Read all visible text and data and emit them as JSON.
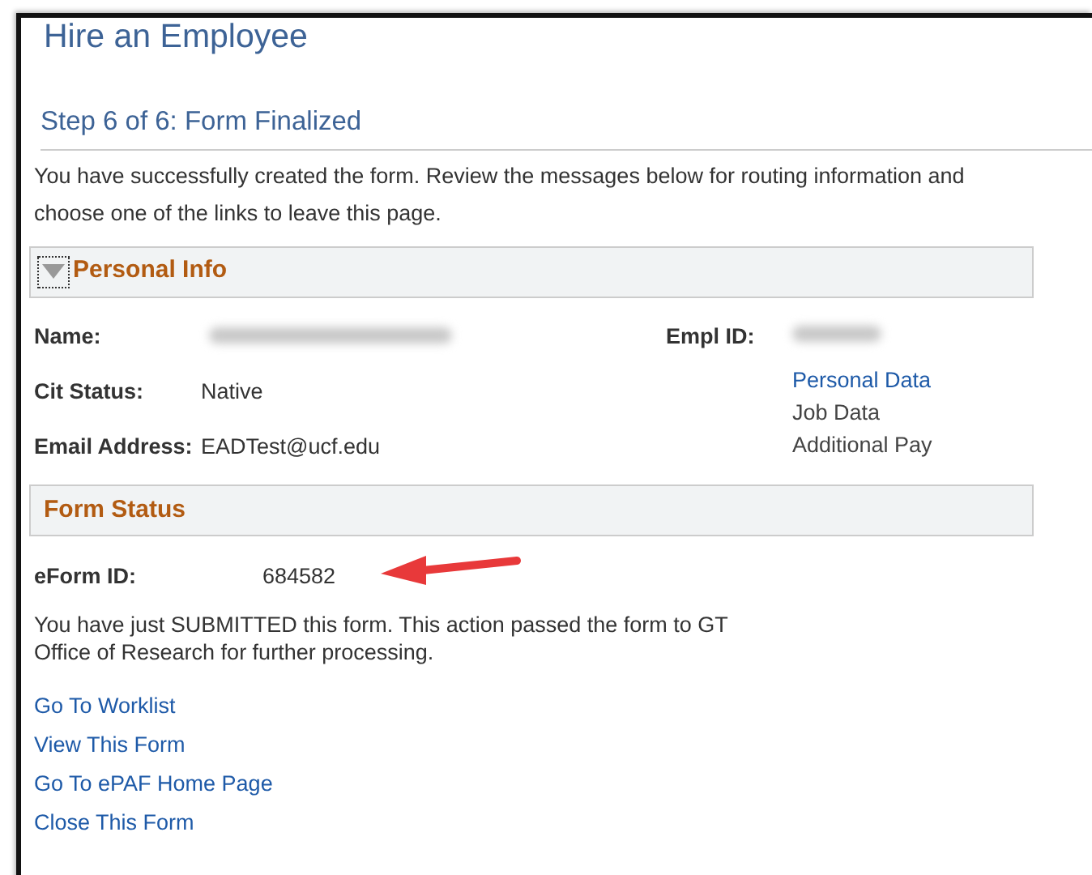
{
  "page_title": "Hire an Employee",
  "step_title": "Step 6 of 6: Form Finalized",
  "intro": "You have successfully created the form. Review the messages below for routing information and choose one of the links to leave this page.",
  "personal_info": {
    "header": "Personal Info",
    "expanded": true,
    "fields": [
      {
        "label": "Name:",
        "redacted": true
      },
      {
        "label": "Cit Status:",
        "value": "Native"
      },
      {
        "label": "Email Address:",
        "value": "EADTest@ucf.edu"
      }
    ],
    "empl_id": {
      "label": "Empl ID:",
      "redacted": true
    },
    "links": [
      {
        "text": "Personal Data",
        "disabled": false
      },
      {
        "text": "Job Data",
        "disabled": true
      },
      {
        "text": "Additional Pay",
        "disabled": true
      }
    ]
  },
  "form_status": {
    "header": "Form Status",
    "eform_label": "eForm ID:",
    "eform_id": "684582",
    "message": "You have just SUBMITTED this form. This action passed the form to GT Office of Research for further processing.",
    "links": [
      "Go To Worklist",
      "View This Form",
      "Go To ePAF Home Page",
      "Close This Form"
    ]
  }
}
